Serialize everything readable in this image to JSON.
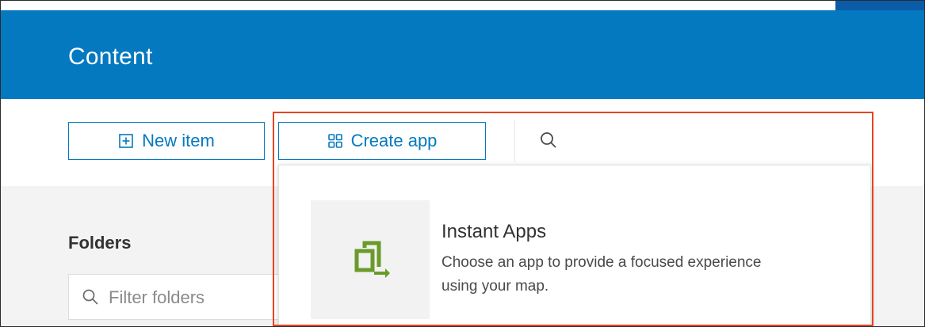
{
  "header": {
    "title": "Content"
  },
  "toolbar": {
    "new_item_label": "New item",
    "create_app_label": "Create app",
    "search_value": "",
    "search_placeholder": ""
  },
  "folders": {
    "title": "Folders",
    "filter_placeholder": "Filter folders"
  },
  "create_app_menu": {
    "items": [
      {
        "title": "Instant Apps",
        "description": "Choose an app to provide a focused experience using your map.",
        "icon": "instant-apps-icon"
      }
    ]
  },
  "colors": {
    "brand_blue": "#0479c0",
    "highlight_outline": "#e8431f",
    "instant_apps_green": "#6a9b2a"
  }
}
